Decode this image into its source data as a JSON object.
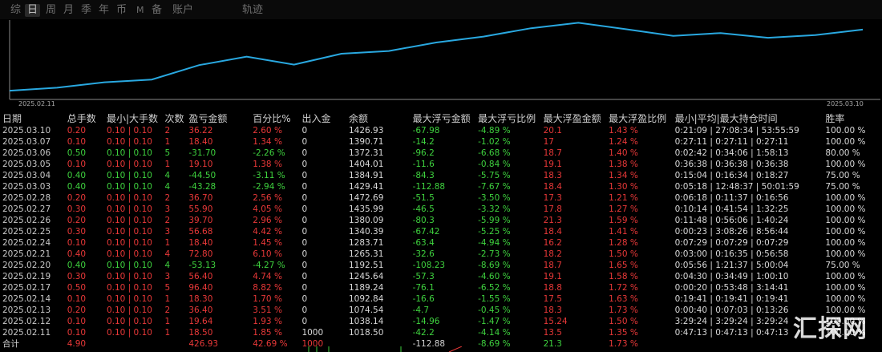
{
  "tabs": [
    "综",
    "日",
    "周",
    "月",
    "季",
    "年",
    "币",
    "M",
    "备",
    "账户",
    "轨迹"
  ],
  "active_tab": "日",
  "chart": {
    "x_start": "2025.02.11",
    "x_end": "2025.03.10",
    "line_color": "#29a8e0",
    "values": [
      1018.5,
      1038.14,
      1074.54,
      1092.84,
      1189.24,
      1245.64,
      1192.51,
      1265.31,
      1283.71,
      1340.39,
      1380.09,
      1435.99,
      1472.69,
      1429.41,
      1384.91,
      1404.01,
      1372.31,
      1390.71,
      1426.93
    ]
  },
  "table": {
    "headers": [
      "日期",
      "总手数",
      "最小|大手数",
      "次数",
      "盈亏金额",
      "百分比%",
      "出入金",
      "余额",
      "最大浮亏金额",
      "最大浮亏比例",
      "最大浮盈金额",
      "最大浮盈比例",
      "最小|平均|最大持仓时间",
      "胜率"
    ],
    "rows": [
      {
        "date": "2025.03.10",
        "lots": "0.20",
        "minmax": "0.10 | 0.10",
        "count": "2",
        "pnl": "36.22",
        "pct": "2.60 %",
        "io": "0",
        "bal": "1426.93",
        "ddamt": "-67.98",
        "ddpct": "-4.89 %",
        "fpamt": "20.1",
        "fppct": "1.43 %",
        "time": "0:21:09 | 27:08:34 | 53:55:59",
        "win": "100.00 %",
        "sign": "pos"
      },
      {
        "date": "2025.03.07",
        "lots": "0.10",
        "minmax": "0.10 | 0.10",
        "count": "1",
        "pnl": "18.40",
        "pct": "1.34 %",
        "io": "0",
        "bal": "1390.71",
        "ddamt": "-14.2",
        "ddpct": "-1.02 %",
        "fpamt": "17",
        "fppct": "1.24 %",
        "time": "0:27:11 | 0:27:11 | 0:27:11",
        "win": "100.00 %",
        "sign": "pos"
      },
      {
        "date": "2025.03.06",
        "lots": "0.50",
        "minmax": "0.10 | 0.10",
        "count": "5",
        "pnl": "-31.70",
        "pct": "-2.26 %",
        "io": "0",
        "bal": "1372.31",
        "ddamt": "-96.2",
        "ddpct": "-6.68 %",
        "fpamt": "18.7",
        "fppct": "1.40 %",
        "time": "0:02:42 | 0:34:06 | 1:58:13",
        "win": "80.00 %",
        "sign": "neg"
      },
      {
        "date": "2025.03.05",
        "lots": "0.10",
        "minmax": "0.10 | 0.10",
        "count": "1",
        "pnl": "19.10",
        "pct": "1.38 %",
        "io": "0",
        "bal": "1404.01",
        "ddamt": "-11.6",
        "ddpct": "-0.84 %",
        "fpamt": "19.1",
        "fppct": "1.38 %",
        "time": "0:36:38 | 0:36:38 | 0:36:38",
        "win": "100.00 %",
        "sign": "pos"
      },
      {
        "date": "2025.03.04",
        "lots": "0.40",
        "minmax": "0.10 | 0.10",
        "count": "4",
        "pnl": "-44.50",
        "pct": "-3.11 %",
        "io": "0",
        "bal": "1384.91",
        "ddamt": "-84.3",
        "ddpct": "-5.75 %",
        "fpamt": "18.3",
        "fppct": "1.34 %",
        "time": "0:15:04 | 0:16:34 | 0:18:27",
        "win": "75.00 %",
        "sign": "neg"
      },
      {
        "date": "2025.03.03",
        "lots": "0.40",
        "minmax": "0.10 | 0.10",
        "count": "4",
        "pnl": "-43.28",
        "pct": "-2.94 %",
        "io": "0",
        "bal": "1429.41",
        "ddamt": "-112.88",
        "ddpct": "-7.67 %",
        "fpamt": "18.4",
        "fppct": "1.30 %",
        "time": "0:05:18 | 12:48:37 | 50:01:59",
        "win": "75.00 %",
        "sign": "neg"
      },
      {
        "date": "2025.02.28",
        "lots": "0.20",
        "minmax": "0.10 | 0.10",
        "count": "2",
        "pnl": "36.70",
        "pct": "2.56 %",
        "io": "0",
        "bal": "1472.69",
        "ddamt": "-51.5",
        "ddpct": "-3.50 %",
        "fpamt": "17.3",
        "fppct": "1.21 %",
        "time": "0:06:18 | 0:11:37 | 0:16:56",
        "win": "100.00 %",
        "sign": "pos"
      },
      {
        "date": "2025.02.27",
        "lots": "0.30",
        "minmax": "0.10 | 0.10",
        "count": "3",
        "pnl": "55.90",
        "pct": "4.05 %",
        "io": "0",
        "bal": "1435.99",
        "ddamt": "-46.5",
        "ddpct": "-3.32 %",
        "fpamt": "17.8",
        "fppct": "1.27 %",
        "time": "0:10:14 | 0:41:54 | 1:32:25",
        "win": "100.00 %",
        "sign": "pos"
      },
      {
        "date": "2025.02.26",
        "lots": "0.20",
        "minmax": "0.10 | 0.10",
        "count": "2",
        "pnl": "39.70",
        "pct": "2.96 %",
        "io": "0",
        "bal": "1380.09",
        "ddamt": "-80.3",
        "ddpct": "-5.99 %",
        "fpamt": "21.3",
        "fppct": "1.59 %",
        "time": "0:11:48 | 0:56:06 | 1:40:24",
        "win": "100.00 %",
        "sign": "pos"
      },
      {
        "date": "2025.02.25",
        "lots": "0.30",
        "minmax": "0.10 | 0.10",
        "count": "3",
        "pnl": "56.68",
        "pct": "4.42 %",
        "io": "0",
        "bal": "1340.39",
        "ddamt": "-67.42",
        "ddpct": "-5.25 %",
        "fpamt": "18.4",
        "fppct": "1.41 %",
        "time": "0:00:23 | 3:08:26 | 8:56:44",
        "win": "100.00 %",
        "sign": "pos"
      },
      {
        "date": "2025.02.24",
        "lots": "0.10",
        "minmax": "0.10 | 0.10",
        "count": "1",
        "pnl": "18.40",
        "pct": "1.45 %",
        "io": "0",
        "bal": "1283.71",
        "ddamt": "-63.4",
        "ddpct": "-4.94 %",
        "fpamt": "16.2",
        "fppct": "1.28 %",
        "time": "0:07:29 | 0:07:29 | 0:07:29",
        "win": "100.00 %",
        "sign": "pos"
      },
      {
        "date": "2025.02.21",
        "lots": "0.40",
        "minmax": "0.10 | 0.10",
        "count": "4",
        "pnl": "72.80",
        "pct": "6.10 %",
        "io": "0",
        "bal": "1265.31",
        "ddamt": "-32.6",
        "ddpct": "-2.73 %",
        "fpamt": "18.2",
        "fppct": "1.50 %",
        "time": "0:03:00 | 0:16:35 | 0:56:58",
        "win": "100.00 %",
        "sign": "pos"
      },
      {
        "date": "2025.02.20",
        "lots": "0.40",
        "minmax": "0.10 | 0.10",
        "count": "4",
        "pnl": "-53.13",
        "pct": "-4.27 %",
        "io": "0",
        "bal": "1192.51",
        "ddamt": "-108.23",
        "ddpct": "-8.69 %",
        "fpamt": "18.7",
        "fppct": "1.65 %",
        "time": "0:05:56 | 1:21:37 | 5:00:04",
        "win": "75.00 %",
        "sign": "neg"
      },
      {
        "date": "2025.02.19",
        "lots": "0.30",
        "minmax": "0.10 | 0.10",
        "count": "3",
        "pnl": "56.40",
        "pct": "4.74 %",
        "io": "0",
        "bal": "1245.64",
        "ddamt": "-57.3",
        "ddpct": "-4.60 %",
        "fpamt": "19.1",
        "fppct": "1.58 %",
        "time": "0:04:30 | 0:34:49 | 1:00:10",
        "win": "100.00 %",
        "sign": "pos"
      },
      {
        "date": "2025.02.17",
        "lots": "0.50",
        "minmax": "0.10 | 0.10",
        "count": "5",
        "pnl": "96.40",
        "pct": "8.82 %",
        "io": "0",
        "bal": "1189.24",
        "ddamt": "-76.1",
        "ddpct": "-6.52 %",
        "fpamt": "18.8",
        "fppct": "1.72 %",
        "time": "0:00:20 | 0:53:48 | 3:14:41",
        "win": "100.00 %",
        "sign": "pos"
      },
      {
        "date": "2025.02.14",
        "lots": "0.10",
        "minmax": "0.10 | 0.10",
        "count": "1",
        "pnl": "18.30",
        "pct": "1.70 %",
        "io": "0",
        "bal": "1092.84",
        "ddamt": "-16.6",
        "ddpct": "-1.55 %",
        "fpamt": "17.5",
        "fppct": "1.63 %",
        "time": "0:19:41 | 0:19:41 | 0:19:41",
        "win": "100.00 %",
        "sign": "pos"
      },
      {
        "date": "2025.02.13",
        "lots": "0.20",
        "minmax": "0.10 | 0.10",
        "count": "2",
        "pnl": "36.40",
        "pct": "3.51 %",
        "io": "0",
        "bal": "1074.54",
        "ddamt": "-4.7",
        "ddpct": "-0.45 %",
        "fpamt": "18.3",
        "fppct": "1.73 %",
        "time": "0:00:40 | 0:07:03 | 0:13:26",
        "win": "100.00 %",
        "sign": "pos"
      },
      {
        "date": "2025.02.12",
        "lots": "0.10",
        "minmax": "0.10 | 0.10",
        "count": "1",
        "pnl": "19.64",
        "pct": "1.93 %",
        "io": "0",
        "bal": "1038.14",
        "ddamt": "-14.96",
        "ddpct": "-1.47 %",
        "fpamt": "15.24",
        "fppct": "1.50 %",
        "time": "3:29:24 | 3:29:24 | 3:29:24",
        "win": "100.00 %",
        "sign": "pos"
      },
      {
        "date": "2025.02.11",
        "lots": "0.10",
        "minmax": "0.10 | 0.10",
        "count": "1",
        "pnl": "18.50",
        "pct": "1.85 %",
        "io": "1000",
        "bal": "1018.50",
        "ddamt": "-42.2",
        "ddpct": "-4.14 %",
        "fpamt": "13.5",
        "fppct": "1.35 %",
        "time": "0:47:13 | 0:47:13 | 0:47:13",
        "win": "100.00 %",
        "sign": "pos"
      }
    ],
    "total": {
      "label": "合计",
      "lots": "4.90",
      "pnl": "426.93",
      "pct": "42.69 %",
      "io": "1000",
      "ddamt": "-112.88",
      "ddpct": "-8.69 %",
      "fpamt": "21.3",
      "fppct": "1.73 %"
    }
  },
  "watermark": "汇探网",
  "colors": {
    "positive": "#e83838",
    "negative": "#3ed13e",
    "line": "#29a8e0"
  }
}
